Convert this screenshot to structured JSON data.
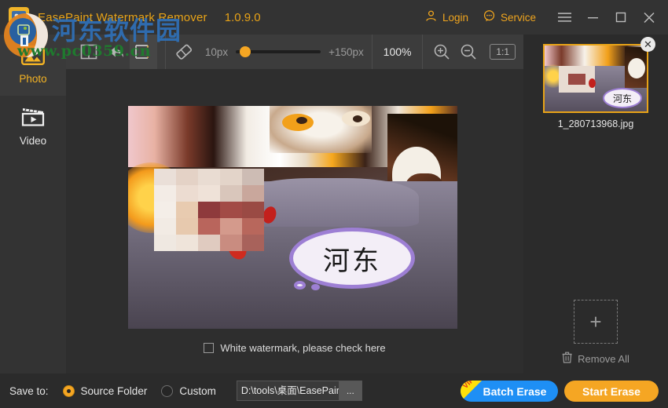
{
  "titlebar": {
    "app_name": "EasePaint Watermark Remover",
    "version": "1.0.9.0",
    "login_label": "Login",
    "service_label": "Service",
    "menu_icon": "hamburger-menu-icon",
    "minimize_icon": "minimize-icon",
    "maximize_icon": "maximize-icon",
    "close_icon": "close-icon",
    "accent_color": "#e8a317"
  },
  "watermark_overlay": {
    "site_name_cn": "河东软件园",
    "site_url": "www.pc0359.cn",
    "cn_color": "#2f6fb5",
    "url_color": "#1f7a2e"
  },
  "sidebar": {
    "items": [
      {
        "label": "Photo",
        "icon": "image-icon",
        "active": true
      },
      {
        "label": "Video",
        "icon": "video-clapper-icon",
        "active": false
      }
    ],
    "active_color": "#f4b324"
  },
  "toolbar": {
    "tools": [
      {
        "name": "compare-split-view",
        "icon": "split-view-icon",
        "selected": false
      },
      {
        "name": "undo",
        "icon": "undo-arrow-icon",
        "selected": false
      },
      {
        "name": "rectangle-select",
        "icon": "marquee-select-icon",
        "selected": true
      },
      {
        "name": "eraser",
        "icon": "eraser-icon",
        "selected": false
      }
    ],
    "brush_min_label": "10px",
    "brush_max_label": "+150px",
    "brush_value_pct": 5,
    "zoom_level": "100%",
    "zoom_in_icon": "magnifier-plus-icon",
    "zoom_out_icon": "magnifier-minus-icon",
    "actual_size_label": "1:1",
    "slider_color": "#f5a623"
  },
  "canvas": {
    "image_caption_cn": "河东",
    "checkbox": {
      "label": "White watermark, please check here",
      "checked": false
    }
  },
  "right_panel": {
    "thumbnail": {
      "filename": "1_280713968.jpg",
      "caption_cn": "河东",
      "close_icon": "close-icon",
      "border_color": "#e8a317"
    },
    "add_button_label": "+",
    "add_button_icon": "plus-icon",
    "remove_all_label": "Remove All",
    "remove_all_icon": "trash-icon"
  },
  "bottom_bar": {
    "save_to_label": "Save to:",
    "options": [
      {
        "label": "Source Folder",
        "selected": true
      },
      {
        "label": "Custom",
        "selected": false
      }
    ],
    "path_value": "D:\\tools\\桌面\\EasePaint_",
    "path_placeholder": "D:\\tools\\桌面\\EasePaint_",
    "browse_label": "...",
    "batch_erase_label": "Batch Erase",
    "batch_vip_badge": "VIP",
    "batch_color": "#1e8ff5",
    "start_erase_label": "Start Erase",
    "start_color": "#f5a623"
  }
}
